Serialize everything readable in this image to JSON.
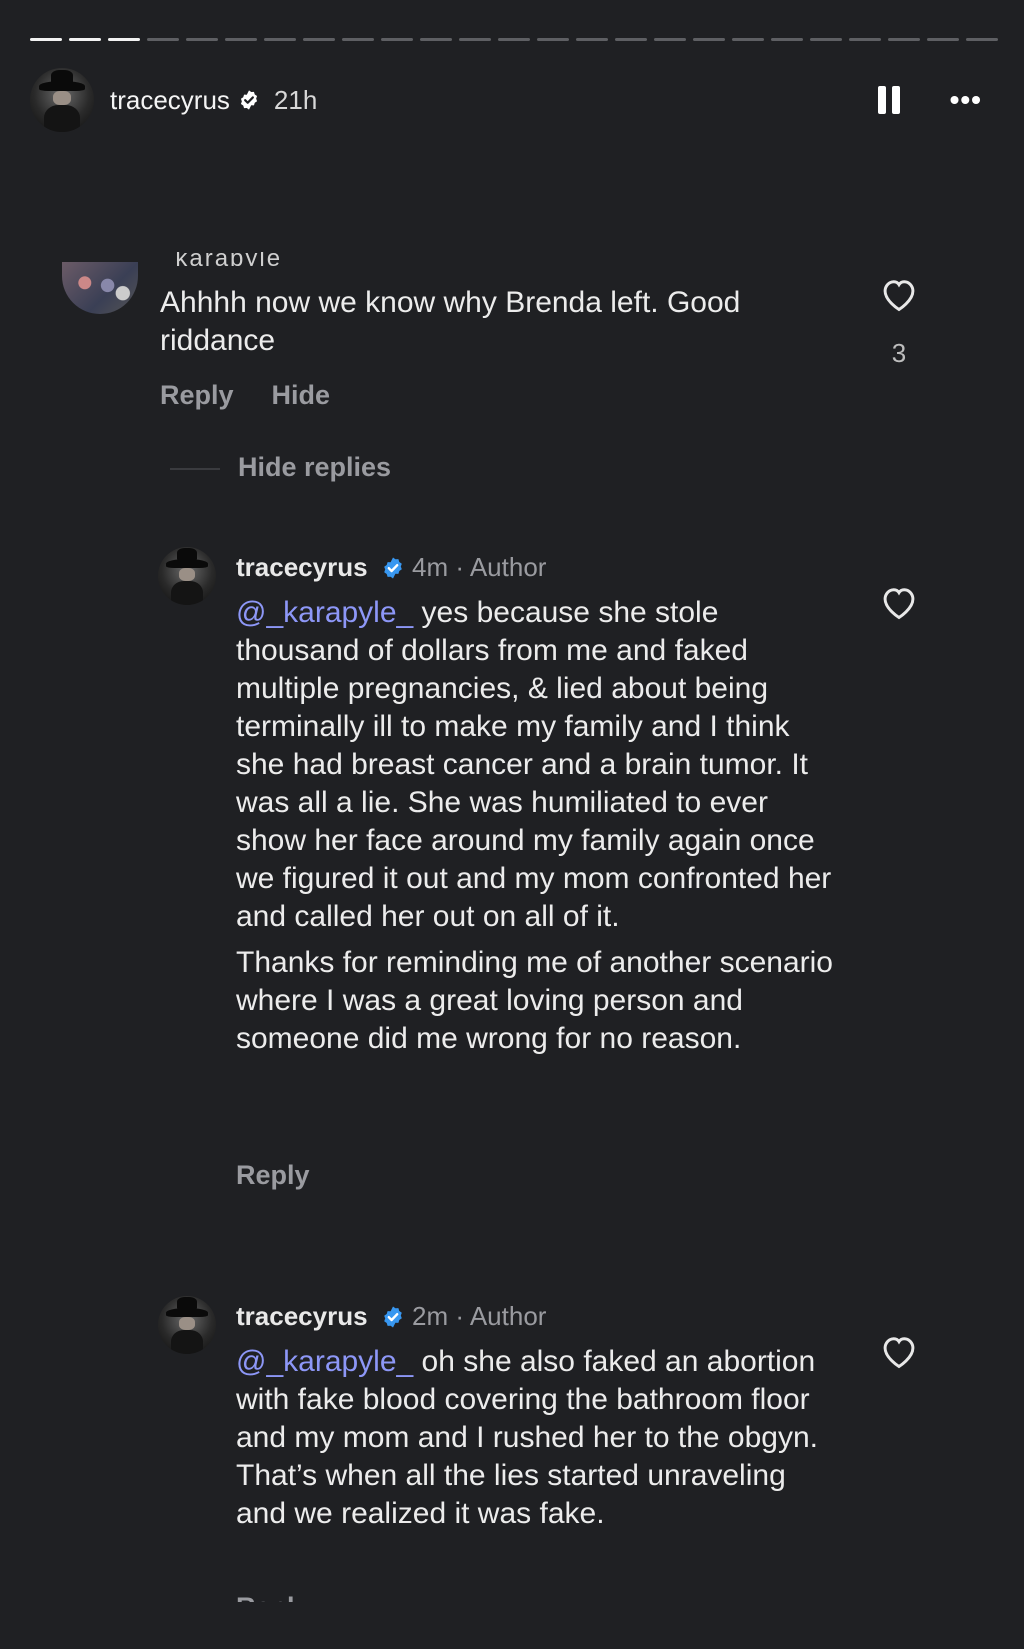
{
  "story": {
    "progress_segments_total": 25,
    "progress_segments_done": 3
  },
  "header": {
    "username": "tracecyrus",
    "time": "21h",
    "pause_icon": "pause-icon",
    "more_icon": "more-horizontal-icon",
    "more_label": "•••"
  },
  "comments": [
    {
      "username_truncated": "_karapyle_",
      "text": "Ahhhh now we know why Brenda left. Good riddance",
      "likes": "3",
      "actions": {
        "reply": "Reply",
        "hide": "Hide"
      }
    }
  ],
  "hide_replies": "Hide replies",
  "replies": [
    {
      "username": "tracecyrus",
      "time": "4m",
      "separator": "·",
      "role": "Author",
      "mention": "@_karapyle_",
      "text_p1": " yes because she stole thousand of dollars from me and faked multiple pregnancies, & lied about being terminally ill  to make my family and I think she had breast cancer and a brain tumor. It was all a lie. She was humiliated to ever show her face around my family again once we figured it out and my mom confronted her and called her out on all of it.",
      "text_p2": "Thanks for reminding me of another scenario where I was a great loving person and someone did me wrong for no reason.",
      "reply": "Reply"
    },
    {
      "username": "tracecyrus",
      "time": "2m",
      "separator": "·",
      "role": "Author",
      "mention": "@_karapyle_",
      "text_p1": " oh she also faked an abortion with fake blood covering the bathroom floor and my mom and I rushed her to the obgyn. That’s when all the lies started unraveling and we realized it was fake.",
      "reply": "Reply"
    }
  ],
  "colors": {
    "background": "#1f2023",
    "mention": "#8d97f7",
    "verified": "#3897f0",
    "muted": "#9a9ba0"
  }
}
